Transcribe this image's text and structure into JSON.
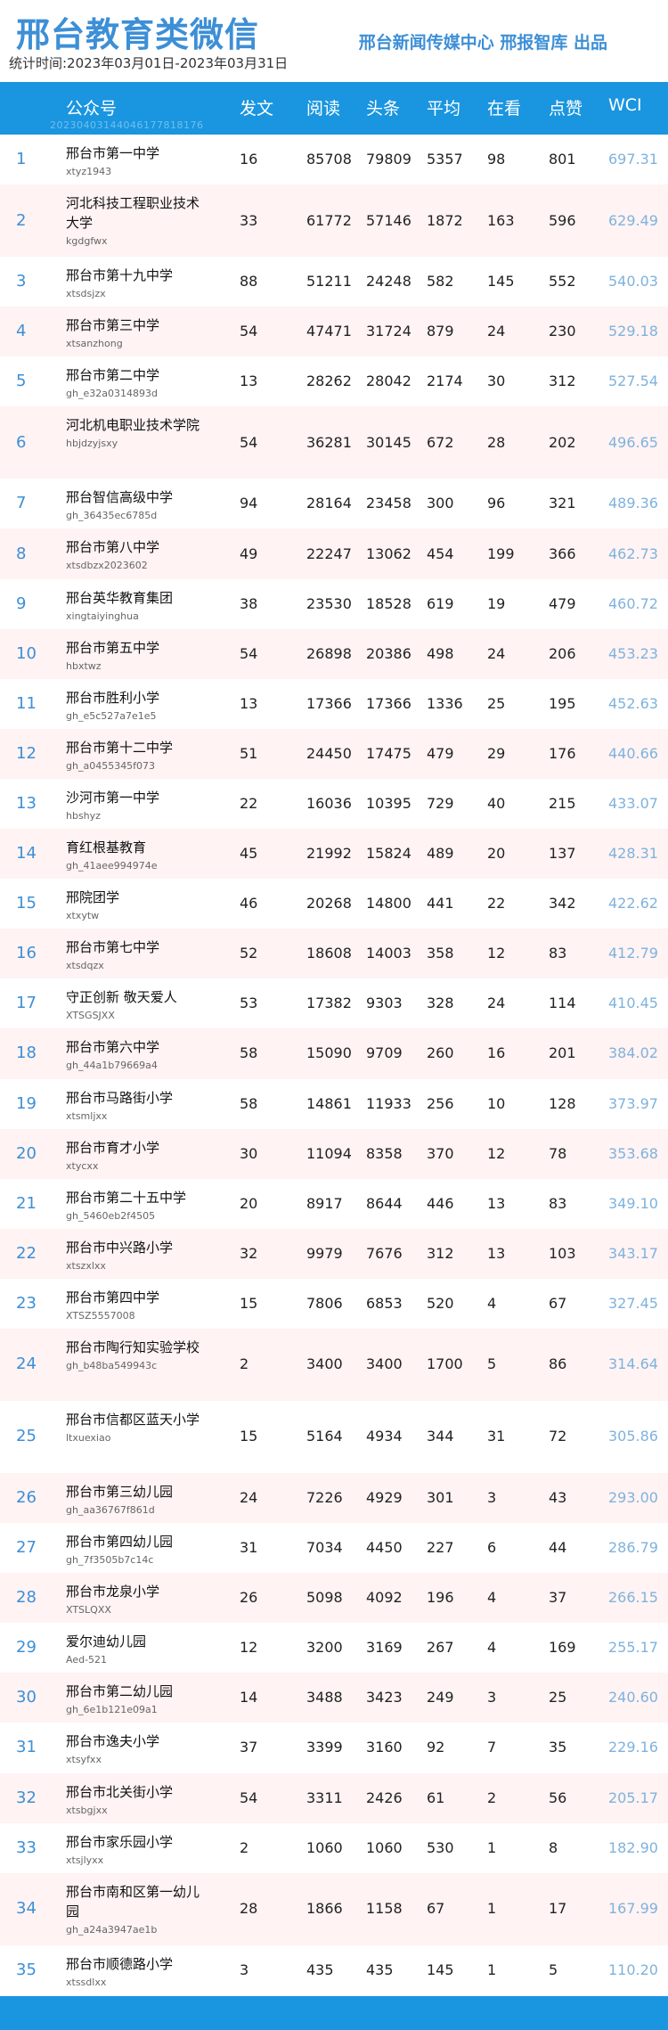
{
  "header": {
    "title": "邢台教育类微信",
    "period": "统计时间:2023年03月01日-2023年03月31日",
    "publisher": "邢台新闻传媒中心  邢报智库  出品"
  },
  "table": {
    "watermark": "20230403144046177818176",
    "columns": [
      "公众号",
      "发文",
      "阅读",
      "头条",
      "平均",
      "在看",
      "点赞",
      "WCI"
    ],
    "rows": [
      {
        "rank": "1",
        "name": "邢台市第一中学",
        "id": "xtyz1943",
        "posts": "16",
        "reads": "85708",
        "headline": "79809",
        "avg": "5357",
        "watching": "98",
        "likes": "801",
        "wci": "697.31"
      },
      {
        "rank": "2",
        "name": "河北科技工程职业技术大学",
        "id": "kgdgfwx",
        "posts": "33",
        "reads": "61772",
        "headline": "57146",
        "avg": "1872",
        "watching": "163",
        "likes": "596",
        "wci": "629.49"
      },
      {
        "rank": "3",
        "name": "邢台市第十九中学",
        "id": "xtsdsjzx",
        "posts": "88",
        "reads": "51211",
        "headline": "24248",
        "avg": "582",
        "watching": "145",
        "likes": "552",
        "wci": "540.03"
      },
      {
        "rank": "4",
        "name": "邢台市第三中学",
        "id": "xtsanzhong",
        "posts": "54",
        "reads": "47471",
        "headline": "31724",
        "avg": "879",
        "watching": "24",
        "likes": "230",
        "wci": "529.18"
      },
      {
        "rank": "5",
        "name": "邢台市第二中学",
        "id": "gh_e32a0314893d",
        "posts": "13",
        "reads": "28262",
        "headline": "28042",
        "avg": "2174",
        "watching": "30",
        "likes": "312",
        "wci": "527.54"
      },
      {
        "rank": "6",
        "name": "河北机电职业技术学院",
        "id": "hbjdzyjsxy",
        "posts": "54",
        "reads": "36281",
        "headline": "30145",
        "avg": "672",
        "watching": "28",
        "likes": "202",
        "wci": "496.65"
      },
      {
        "rank": "7",
        "name": "邢台智信高级中学",
        "id": "gh_36435ec6785d",
        "posts": "94",
        "reads": "28164",
        "headline": "23458",
        "avg": "300",
        "watching": "96",
        "likes": "321",
        "wci": "489.36"
      },
      {
        "rank": "8",
        "name": "邢台市第八中学",
        "id": "xtsdbzx2023602",
        "posts": "49",
        "reads": "22247",
        "headline": "13062",
        "avg": "454",
        "watching": "199",
        "likes": "366",
        "wci": "462.73"
      },
      {
        "rank": "9",
        "name": "邢台英华教育集团",
        "id": "xingtaiyinghua",
        "posts": "38",
        "reads": "23530",
        "headline": "18528",
        "avg": "619",
        "watching": "19",
        "likes": "479",
        "wci": "460.72"
      },
      {
        "rank": "10",
        "name": "邢台市第五中学",
        "id": "hbxtwz",
        "posts": "54",
        "reads": "26898",
        "headline": "20386",
        "avg": "498",
        "watching": "24",
        "likes": "206",
        "wci": "453.23"
      },
      {
        "rank": "11",
        "name": "邢台市胜利小学",
        "id": "gh_e5c527a7e1e5",
        "posts": "13",
        "reads": "17366",
        "headline": "17366",
        "avg": "1336",
        "watching": "25",
        "likes": "195",
        "wci": "452.63"
      },
      {
        "rank": "12",
        "name": "邢台市第十二中学",
        "id": "gh_a0455345f073",
        "posts": "51",
        "reads": "24450",
        "headline": "17475",
        "avg": "479",
        "watching": "29",
        "likes": "176",
        "wci": "440.66"
      },
      {
        "rank": "13",
        "name": "沙河市第一中学",
        "id": "hbshyz",
        "posts": "22",
        "reads": "16036",
        "headline": "10395",
        "avg": "729",
        "watching": "40",
        "likes": "215",
        "wci": "433.07"
      },
      {
        "rank": "14",
        "name": "育红根基教育",
        "id": "gh_41aee994974e",
        "posts": "45",
        "reads": "21992",
        "headline": "15824",
        "avg": "489",
        "watching": "20",
        "likes": "137",
        "wci": "428.31"
      },
      {
        "rank": "15",
        "name": "邢院团学",
        "id": "xtxytw",
        "posts": "46",
        "reads": "20268",
        "headline": "14800",
        "avg": "441",
        "watching": "22",
        "likes": "342",
        "wci": "422.62"
      },
      {
        "rank": "16",
        "name": "邢台市第七中学",
        "id": "xtsdqzx",
        "posts": "52",
        "reads": "18608",
        "headline": "14003",
        "avg": "358",
        "watching": "12",
        "likes": "83",
        "wci": "412.79"
      },
      {
        "rank": "17",
        "name": "守正创新 敬天爱人",
        "id": "XTSGSJXX",
        "posts": "53",
        "reads": "17382",
        "headline": "9303",
        "avg": "328",
        "watching": "24",
        "likes": "114",
        "wci": "410.45"
      },
      {
        "rank": "18",
        "name": "邢台市第六中学",
        "id": "gh_44a1b79669a4",
        "posts": "58",
        "reads": "15090",
        "headline": "9709",
        "avg": "260",
        "watching": "16",
        "likes": "201",
        "wci": "384.02"
      },
      {
        "rank": "19",
        "name": "邢台市马路街小学",
        "id": "xtsmljxx",
        "posts": "58",
        "reads": "14861",
        "headline": "11933",
        "avg": "256",
        "watching": "10",
        "likes": "128",
        "wci": "373.97"
      },
      {
        "rank": "20",
        "name": "邢台市育才小学",
        "id": "xtycxx",
        "posts": "30",
        "reads": "11094",
        "headline": "8358",
        "avg": "370",
        "watching": "12",
        "likes": "78",
        "wci": "353.68"
      },
      {
        "rank": "21",
        "name": "邢台市第二十五中学",
        "id": "gh_5460eb2f4505",
        "posts": "20",
        "reads": "8917",
        "headline": "8644",
        "avg": "446",
        "watching": "13",
        "likes": "83",
        "wci": "349.10"
      },
      {
        "rank": "22",
        "name": "邢台市中兴路小学",
        "id": "xtszxlxx",
        "posts": "32",
        "reads": "9979",
        "headline": "7676",
        "avg": "312",
        "watching": "13",
        "likes": "103",
        "wci": "343.17"
      },
      {
        "rank": "23",
        "name": "邢台市第四中学",
        "id": "XTSZ5557008",
        "posts": "15",
        "reads": "7806",
        "headline": "6853",
        "avg": "520",
        "watching": "4",
        "likes": "67",
        "wci": "327.45"
      },
      {
        "rank": "24",
        "name": "邢台市陶行知实验学校",
        "id": "gh_b48ba549943c",
        "posts": "2",
        "reads": "3400",
        "headline": "3400",
        "avg": "1700",
        "watching": "5",
        "likes": "86",
        "wci": "314.64"
      },
      {
        "rank": "25",
        "name": "邢台市信都区蓝天小学",
        "id": "ltxuexiao",
        "posts": "15",
        "reads": "5164",
        "headline": "4934",
        "avg": "344",
        "watching": "31",
        "likes": "72",
        "wci": "305.86"
      },
      {
        "rank": "26",
        "name": "邢台市第三幼儿园",
        "id": "gh_aa36767f861d",
        "posts": "24",
        "reads": "7226",
        "headline": "4929",
        "avg": "301",
        "watching": "3",
        "likes": "43",
        "wci": "293.00"
      },
      {
        "rank": "27",
        "name": "邢台市第四幼儿园",
        "id": "gh_7f3505b7c14c",
        "posts": "31",
        "reads": "7034",
        "headline": "4450",
        "avg": "227",
        "watching": "6",
        "likes": "44",
        "wci": "286.79"
      },
      {
        "rank": "28",
        "name": "邢台市龙泉小学",
        "id": "XTSLQXX",
        "posts": "26",
        "reads": "5098",
        "headline": "4092",
        "avg": "196",
        "watching": "4",
        "likes": "37",
        "wci": "266.15"
      },
      {
        "rank": "29",
        "name": "爱尔迪幼儿园",
        "id": "Aed-521",
        "posts": "12",
        "reads": "3200",
        "headline": "3169",
        "avg": "267",
        "watching": "4",
        "likes": "169",
        "wci": "255.17"
      },
      {
        "rank": "30",
        "name": "邢台市第二幼儿园",
        "id": "gh_6e1b121e09a1",
        "posts": "14",
        "reads": "3488",
        "headline": "3423",
        "avg": "249",
        "watching": "3",
        "likes": "25",
        "wci": "240.60"
      },
      {
        "rank": "31",
        "name": "邢台市逸夫小学",
        "id": "xtsyfxx",
        "posts": "37",
        "reads": "3399",
        "headline": "3160",
        "avg": "92",
        "watching": "7",
        "likes": "35",
        "wci": "229.16"
      },
      {
        "rank": "32",
        "name": "邢台市北关街小学",
        "id": "xtsbgjxx",
        "posts": "54",
        "reads": "3311",
        "headline": "2426",
        "avg": "61",
        "watching": "2",
        "likes": "56",
        "wci": "205.17"
      },
      {
        "rank": "33",
        "name": "邢台市家乐园小学",
        "id": "xtsjlyxx",
        "posts": "2",
        "reads": "1060",
        "headline": "1060",
        "avg": "530",
        "watching": "1",
        "likes": "8",
        "wci": "182.90"
      },
      {
        "rank": "34",
        "name": "邢台市南和区第一幼儿园",
        "id": "gh_a24a3947ae1b",
        "posts": "28",
        "reads": "1866",
        "headline": "1158",
        "avg": "67",
        "watching": "1",
        "likes": "17",
        "wci": "167.99"
      },
      {
        "rank": "35",
        "name": "邢台市顺德路小学",
        "id": "xtssdlxx",
        "posts": "3",
        "reads": "435",
        "headline": "435",
        "avg": "145",
        "watching": "1",
        "likes": "5",
        "wci": "110.20"
      }
    ]
  }
}
